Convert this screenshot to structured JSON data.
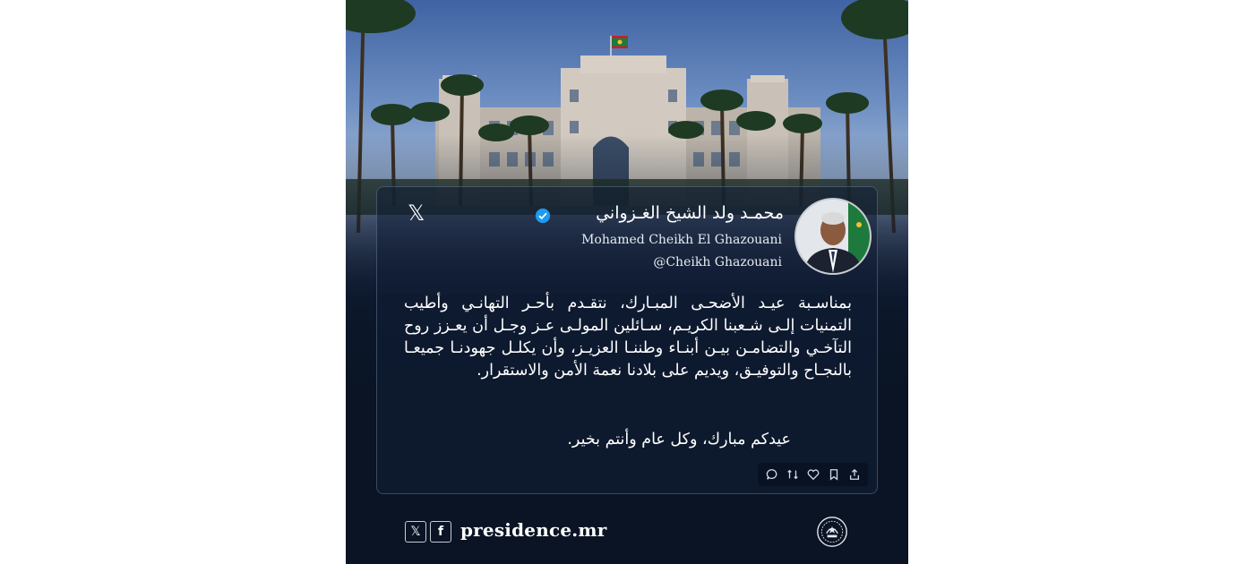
{
  "post": {
    "name_ar": "محمـد ولد الشيخ الغـزواني",
    "name_en": "Mohamed Cheikh El Ghazouani",
    "handle": "@Cheikh Ghazouani",
    "verified": true,
    "body": "بمناسـبة عيـد الأضحـى المبـارك، نتقـدم بأحـر التهانـي وأطيب التمنيات إلـى شـعبنا الكريـم، سـائلين المولـى عـز وجـل أن يعـزز روح التآخـي والتضامـن بيـن أبنـاء وطننـا العزيـز، وأن يكلـل جهودنـا جميعـا بالنجـاح والتوفيـق، ويديم على بلادنا نعمة الأمن والاستقرار.",
    "closing": "عيدكم مبارك، وكل عام وأنتم بخير.",
    "platform_icon": "x-logo-icon",
    "actions": [
      "reply-icon",
      "repost-icon",
      "like-icon",
      "bookmark-icon",
      "share-icon"
    ]
  },
  "footer": {
    "site": "presidence.mr",
    "social": [
      "x-icon",
      "facebook-icon"
    ],
    "seal_icon": "presidency-seal-icon"
  },
  "colors": {
    "background_top": "#3f63a3",
    "background_bottom": "#0a1424",
    "card_border": "#8caad2",
    "verified": "#1d9bf0",
    "text": "#ffffff"
  }
}
